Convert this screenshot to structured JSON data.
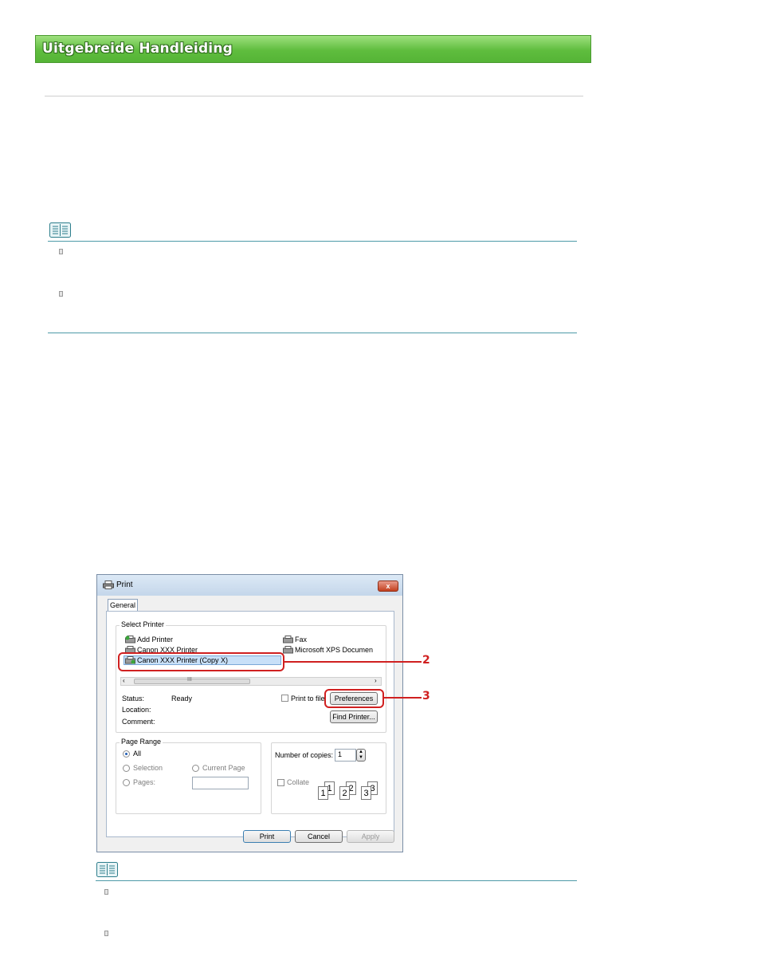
{
  "header": {
    "title": "Uitgebreide Handleiding"
  },
  "print_dialog": {
    "title": "Print",
    "close_label": "x",
    "tab_label": "General",
    "select_printer_label": "Select Printer",
    "printers": [
      "Add Printer",
      "Canon XXX Printer",
      "Canon XXX Printer (Copy X)",
      "Fax",
      "Microsoft XPS Documen"
    ],
    "scroll_grip": "III",
    "status_label": "Status:",
    "status_value": "Ready",
    "location_label": "Location:",
    "comment_label": "Comment:",
    "print_to_file_label": "Print to file",
    "preferences_label": "Preferences",
    "find_printer_label": "Find Printer...",
    "page_range_label": "Page Range",
    "range_options": [
      "All",
      "Selection",
      "Current Page",
      "Pages:"
    ],
    "copies_label": "Number of copies:",
    "copies_value": "1",
    "collate_label": "Collate",
    "collate_pages": [
      "1",
      "1",
      "2",
      "2",
      "3",
      "3"
    ],
    "print_label": "Print",
    "cancel_label": "Cancel",
    "apply_label": "Apply"
  },
  "callouts": [
    "2",
    "3"
  ],
  "colors": {
    "banner": "#5fbd3e",
    "note_rule": "#4d9aa8",
    "callout": "#d02020"
  }
}
